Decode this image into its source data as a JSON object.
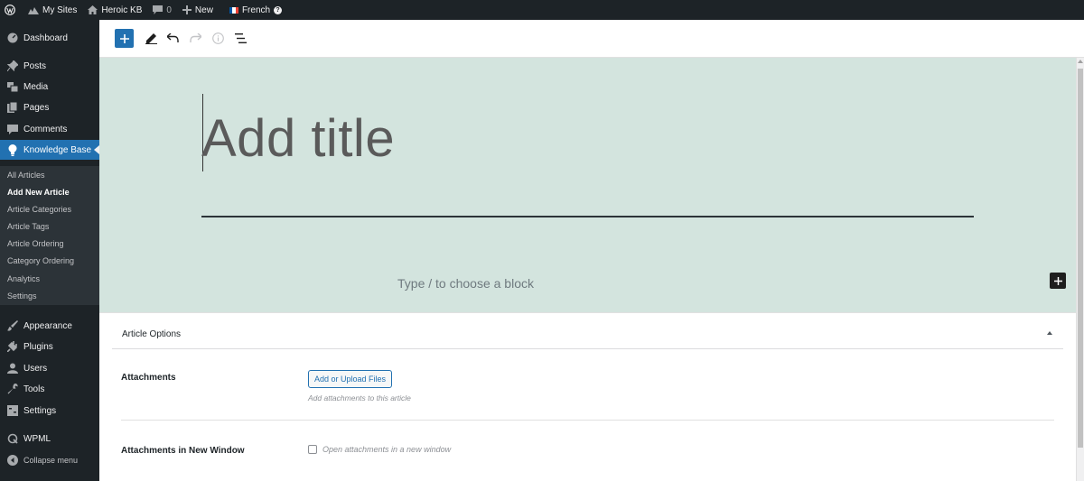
{
  "admin_bar": {
    "my_sites": "My Sites",
    "site_name": "Heroic KB",
    "comments_count": "0",
    "new_label": "New",
    "language": "French",
    "help": "?"
  },
  "sidebar": {
    "dashboard": "Dashboard",
    "posts": "Posts",
    "media": "Media",
    "pages": "Pages",
    "comments": "Comments",
    "knowledge_base": "Knowledge Base",
    "submenu": [
      "All Articles",
      "Add New Article",
      "Article Categories",
      "Article Tags",
      "Article Ordering",
      "Category Ordering",
      "Analytics",
      "Settings"
    ],
    "appearance": "Appearance",
    "plugins": "Plugins",
    "users": "Users",
    "tools": "Tools",
    "settings": "Settings",
    "wpml": "WPML",
    "collapse": "Collapse menu"
  },
  "editor": {
    "title_placeholder": "Add title",
    "block_placeholder": "Type / to choose a block"
  },
  "article_options": {
    "panel_title": "Article Options",
    "attachments_label": "Attachments",
    "upload_button": "Add or Upload Files",
    "attachments_help": "Add attachments to this article",
    "new_window_label": "Attachments in New Window",
    "new_window_checkbox_label": "Open attachments in a new window"
  },
  "colors": {
    "accent": "#2271b1",
    "admin_dark": "#1d2327",
    "canvas_bg": "#d3e4de",
    "flag": [
      "#0055a4",
      "#ffffff",
      "#ef4135"
    ]
  }
}
